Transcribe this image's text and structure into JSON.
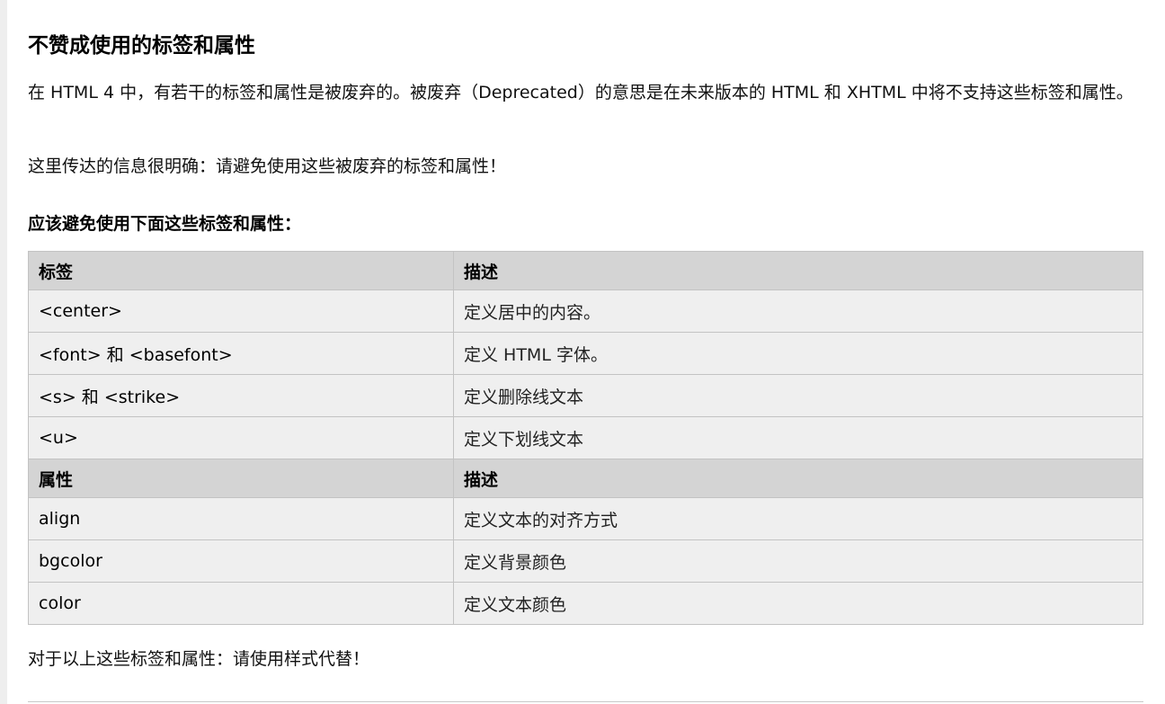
{
  "title": "不赞成使用的标签和属性",
  "intro": "在 HTML 4 中，有若干的标签和属性是被废弃的。被废弃（Deprecated）的意思是在未来版本的 HTML 和 XHTML 中将不支持这些标签和属性。",
  "message": "这里传达的信息很明确：请避免使用这些被废弃的标签和属性！",
  "avoid_heading": "应该避免使用下面这些标签和属性：",
  "table": {
    "tag_header": [
      "标签",
      "描述"
    ],
    "tag_rows": [
      [
        "<center>",
        "定义居中的内容。"
      ],
      [
        "<font> 和 <basefont>",
        "定义 HTML 字体。"
      ],
      [
        "<s> 和 <strike>",
        "定义删除线文本"
      ],
      [
        "<u>",
        "定义下划线文本"
      ]
    ],
    "attr_header": [
      "属性",
      "描述"
    ],
    "attr_rows": [
      [
        "align",
        "定义文本的对齐方式"
      ],
      [
        "bgcolor",
        "定义背景颜色"
      ],
      [
        "color",
        "定义文本颜色"
      ]
    ]
  },
  "closing": "对于以上这些标签和属性：请使用样式代替！"
}
